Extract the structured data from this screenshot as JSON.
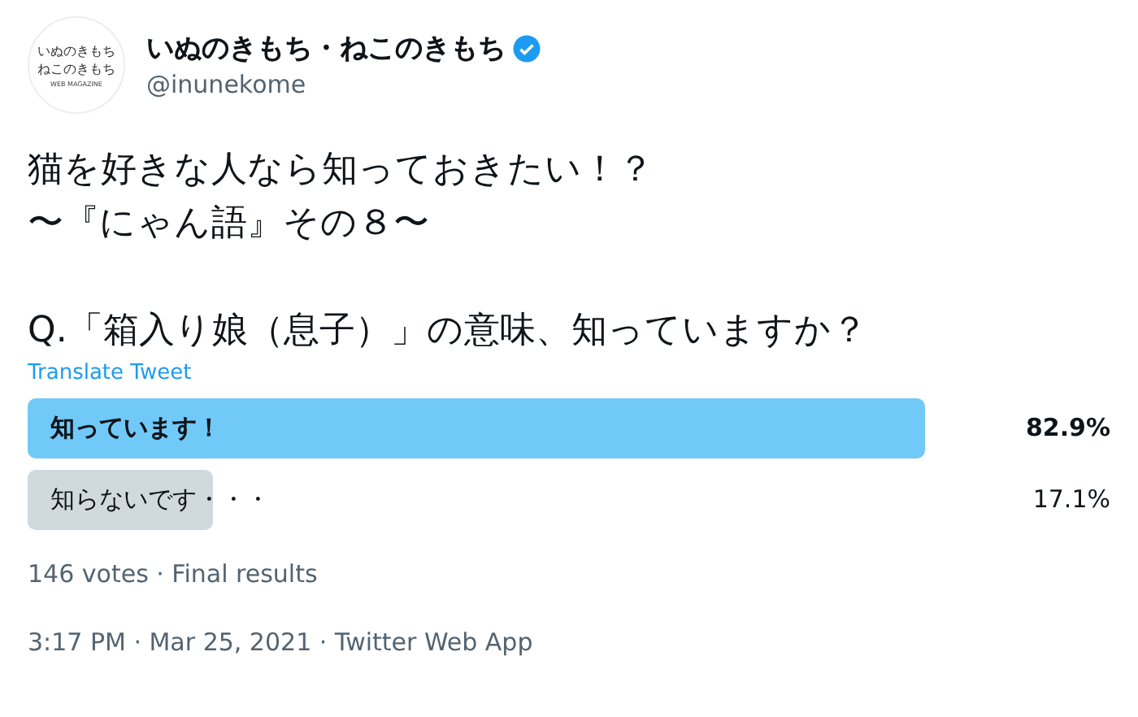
{
  "author": {
    "avatar_lines": [
      "いぬのきもち",
      "ねこのきもち",
      "WEB MAGAZINE"
    ],
    "name": "いぬのきもち・ねこのきもち",
    "verified": true,
    "handle": "@inunekome"
  },
  "tweet": {
    "paragraphs": [
      [
        "猫を好きな人なら知っておきたい！？",
        "〜『にゃん語』その８〜"
      ],
      [
        "Q.「箱入り娘（息子）」の意味、知っていますか？"
      ]
    ],
    "translate": "Translate Tweet"
  },
  "poll": {
    "options": [
      {
        "label": "知っています！",
        "percent": "82.9%",
        "winner": true
      },
      {
        "label": "知らないです・・・",
        "percent": "17.1%",
        "winner": false
      }
    ],
    "summary": "146 votes · Final results"
  },
  "meta": "3:17 PM · Mar 25, 2021 · Twitter Web App"
}
